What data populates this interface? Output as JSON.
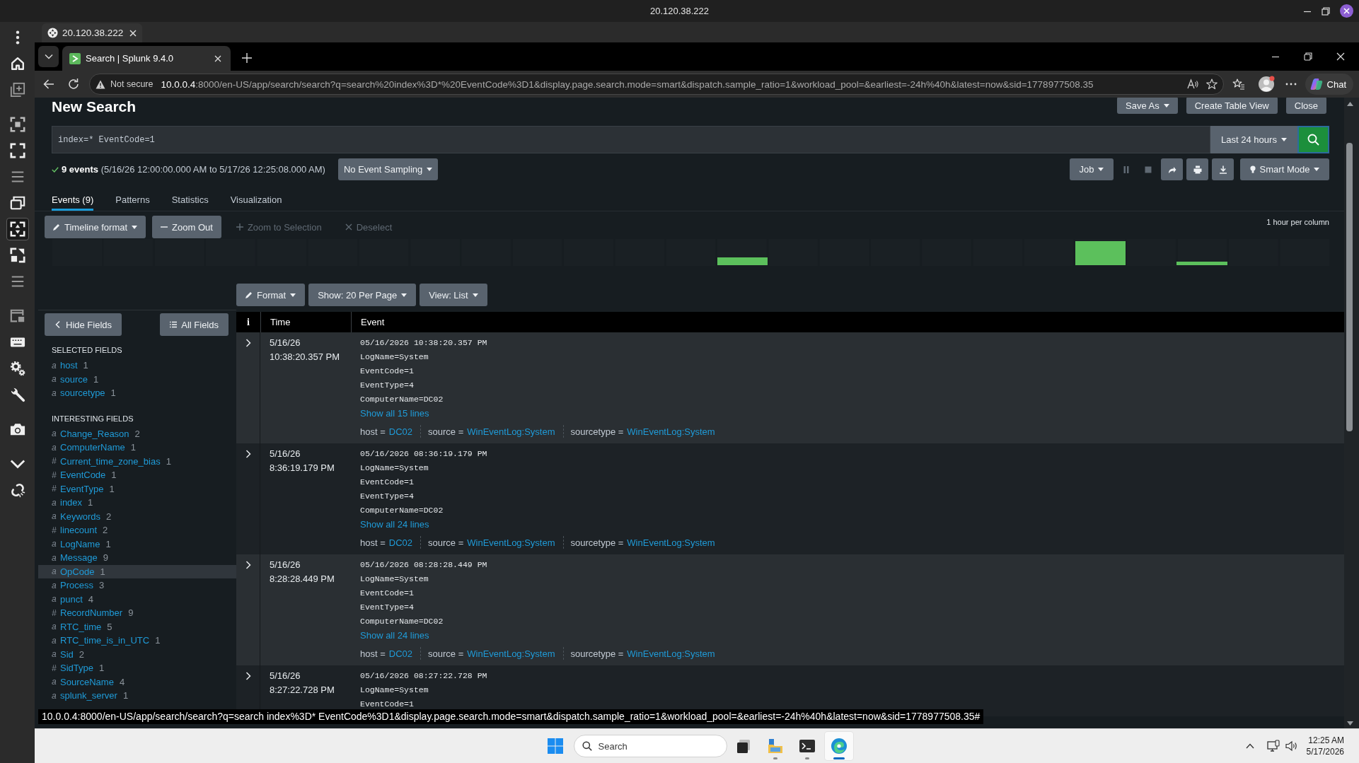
{
  "remote_session": {
    "title": "20.120.38.222",
    "side_toolbar": {
      "groups": [
        {
          "items": [
            {
              "selected": false
            },
            {
              "selected": false
            },
            {
              "selected": false
            }
          ]
        },
        {
          "items": [
            {
              "selected": false
            },
            {
              "selected": false
            },
            {
              "selected": false
            },
            {
              "selected": false
            },
            {
              "selected": true
            },
            {
              "selected": false
            },
            {
              "selected": false
            }
          ]
        },
        {
          "items": [
            {
              "selected": false
            },
            {
              "selected": false
            },
            {
              "selected": false
            },
            {
              "selected": false
            }
          ]
        },
        {
          "items": [
            {
              "selected": false
            }
          ]
        },
        {
          "items": [
            {
              "selected": false
            },
            {
              "selected": false
            }
          ]
        }
      ]
    },
    "tab": {
      "label": "20.120.38.222"
    }
  },
  "browser": {
    "tabs": [
      {
        "title": "Search | Splunk 9.4.0",
        "selected": true
      }
    ],
    "address": {
      "security": "Not secure",
      "host": "10.0.0.4",
      "rest": ":8000/en-US/app/search/search?q=search%20index%3D*%20EventCode%3D1&display.page.search.mode=smart&dispatch.sample_ratio=1&workload_pool=&earliest=-24h%40h&latest=now&sid=1778977508.35"
    },
    "chat": "Chat",
    "status_link": "10.0.0.4:8000/en-US/app/search/search?q=search index%3D* EventCode%3D1&display.page.search.mode=smart&dispatch.sample_ratio=1&workload_pool=&earliest=-24h%40h&latest=now&sid=1778977508.35#"
  },
  "splunk": {
    "title": "New Search",
    "header_buttons": [
      {
        "label": "Save As",
        "kind": "dropdown"
      },
      {
        "label": "Create Table View",
        "kind": "plain"
      },
      {
        "label": "Close",
        "kind": "plain"
      }
    ],
    "search": {
      "query": "index=* EventCode=1",
      "time_range": "Last 24 hours"
    },
    "summary": "**9 events** (5/16/26 12:00:00.000 AM to 5/17/26 12:25:08.000 AM)",
    "sampling": "No Event Sampling",
    "job": {
      "label": "Job",
      "controls": [
        {
          "disabled": true
        },
        {
          "disabled": true
        },
        {
          "disabled": false
        },
        {
          "disabled": false
        },
        {
          "disabled": false
        }
      ],
      "mode": "Smart Mode"
    },
    "tabs": [
      {
        "label": "Events (9)",
        "selected": true
      },
      {
        "label": "Patterns",
        "selected": false
      },
      {
        "label": "Statistics",
        "selected": false
      },
      {
        "label": "Visualization",
        "selected": false
      }
    ],
    "timeline": {
      "buttons": [
        {
          "label": "Timeline format",
          "kind": "format",
          "disabled": false
        },
        {
          "label": "Zoom Out",
          "kind": "zoom-out",
          "disabled": false
        },
        {
          "label": "Zoom to Selection",
          "kind": "zoom-in",
          "disabled": true
        },
        {
          "label": "Deselect",
          "kind": "deselect",
          "disabled": true
        }
      ],
      "scale": "1 hour per column"
    },
    "results_toolbar": [
      {
        "label": "Format",
        "kind": "format"
      },
      {
        "label": "Show: 20 Per Page",
        "kind": "dropdown"
      },
      {
        "label": "View: List",
        "kind": "dropdown"
      }
    ],
    "fields_panel": {
      "hide_button": "Hide Fields",
      "all_button": "All Fields",
      "selected_heading": "SELECTED FIELDS",
      "selected": [
        {
          "type": "a",
          "name": "host",
          "count": "1",
          "highlighted": false
        },
        {
          "type": "a",
          "name": "source",
          "count": "1",
          "highlighted": false
        },
        {
          "type": "a",
          "name": "sourcetype",
          "count": "1",
          "highlighted": false
        }
      ],
      "interesting_heading": "INTERESTING FIELDS",
      "interesting": [
        {
          "type": "a",
          "name": "Change_Reason",
          "count": "2",
          "highlighted": false
        },
        {
          "type": "a",
          "name": "ComputerName",
          "count": "1",
          "highlighted": false
        },
        {
          "type": "#",
          "name": "Current_time_zone_bias",
          "count": "1",
          "highlighted": false
        },
        {
          "type": "#",
          "name": "EventCode",
          "count": "1",
          "highlighted": false
        },
        {
          "type": "#",
          "name": "EventType",
          "count": "1",
          "highlighted": false
        },
        {
          "type": "a",
          "name": "index",
          "count": "1",
          "highlighted": false
        },
        {
          "type": "a",
          "name": "Keywords",
          "count": "2",
          "highlighted": false
        },
        {
          "type": "#",
          "name": "linecount",
          "count": "2",
          "highlighted": false
        },
        {
          "type": "a",
          "name": "LogName",
          "count": "1",
          "highlighted": false
        },
        {
          "type": "a",
          "name": "Message",
          "count": "9",
          "highlighted": false
        },
        {
          "type": "a",
          "name": "OpCode",
          "count": "1",
          "highlighted": true
        },
        {
          "type": "a",
          "name": "Process",
          "count": "3",
          "highlighted": false
        },
        {
          "type": "a",
          "name": "punct",
          "count": "4",
          "highlighted": false
        },
        {
          "type": "#",
          "name": "RecordNumber",
          "count": "9",
          "highlighted": false
        },
        {
          "type": "a",
          "name": "RTC_time",
          "count": "5",
          "highlighted": false
        },
        {
          "type": "a",
          "name": "RTC_time_is_in_UTC",
          "count": "1",
          "highlighted": false
        },
        {
          "type": "a",
          "name": "Sid",
          "count": "2",
          "highlighted": false
        },
        {
          "type": "#",
          "name": "SidType",
          "count": "1",
          "highlighted": false
        },
        {
          "type": "a",
          "name": "SourceName",
          "count": "4",
          "highlighted": false
        },
        {
          "type": "a",
          "name": "splunk_server",
          "count": "1",
          "highlighted": false
        }
      ]
    },
    "table": {
      "columns": [
        "i",
        "Time",
        "Event"
      ],
      "rows": [
        {
          "date": "5/16/26",
          "time": "10:38:20.357 PM",
          "lines": [
            "05/16/2026 10:38:20.357 PM",
            "LogName=System",
            "EventCode=1",
            "EventType=4",
            "ComputerName=DC02"
          ],
          "show_all": "Show all 15 lines",
          "fields": [
            {
              "label": "host =",
              "value": "DC02"
            },
            {
              "label": "source =",
              "value": "WinEventLog:System"
            },
            {
              "label": "sourcetype =",
              "value": "WinEventLog:System"
            }
          ]
        },
        {
          "date": "5/16/26",
          "time": "8:36:19.179 PM",
          "lines": [
            "05/16/2026 08:36:19.179 PM",
            "LogName=System",
            "EventCode=1",
            "EventType=4",
            "ComputerName=DC02"
          ],
          "show_all": "Show all 24 lines",
          "fields": [
            {
              "label": "host =",
              "value": "DC02"
            },
            {
              "label": "source =",
              "value": "WinEventLog:System"
            },
            {
              "label": "sourcetype =",
              "value": "WinEventLog:System"
            }
          ]
        },
        {
          "date": "5/16/26",
          "time": "8:28:28.449 PM",
          "lines": [
            "05/16/2026 08:28:28.449 PM",
            "LogName=System",
            "EventCode=1",
            "EventType=4",
            "ComputerName=DC02"
          ],
          "show_all": "Show all 24 lines",
          "fields": [
            {
              "label": "host =",
              "value": "DC02"
            },
            {
              "label": "source =",
              "value": "WinEventLog:System"
            },
            {
              "label": "sourcetype =",
              "value": "WinEventLog:System"
            }
          ]
        },
        {
          "date": "5/16/26",
          "time": "8:27:22.728 PM",
          "lines": [
            "05/16/2026 08:27:22.728 PM",
            "LogName=System",
            "EventCode=1"
          ]
        }
      ]
    }
  },
  "taskbar": {
    "search": {
      "placeholder": "Search"
    },
    "apps": [
      {
        "running": false,
        "active": false
      },
      {
        "running": true,
        "active": false
      },
      {
        "running": true,
        "active": false
      },
      {
        "running": true,
        "active": true
      }
    ],
    "time": "12:25 AM",
    "date": "5/17/2026"
  }
}
